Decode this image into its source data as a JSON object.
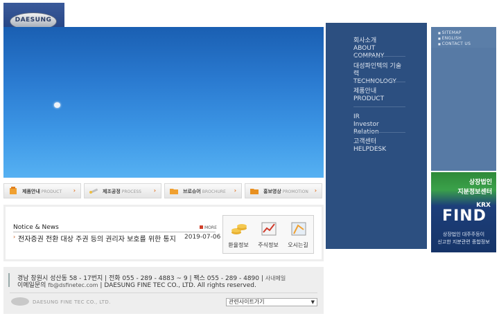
{
  "logo": {
    "text": "DAESUNG"
  },
  "quick_menu": [
    {
      "kr": "제품안내",
      "en": "PRODUCT"
    },
    {
      "kr": "제조공정",
      "en": "PROCESS"
    },
    {
      "kr": "브로슈어",
      "en": "BROCHURE"
    },
    {
      "kr": "홍보영상",
      "en": "PROMOTION"
    }
  ],
  "notice": {
    "title": "Notice & News",
    "more": "MORE",
    "items": [
      {
        "text": "전자증권 전환 대상 주권 등의 권리자 보호를 위한 통지",
        "date": "2019-07-06"
      }
    ]
  },
  "services": [
    {
      "label": "환율정보",
      "icon": "coins-icon"
    },
    {
      "label": "주식정보",
      "icon": "chart-icon"
    },
    {
      "label": "오시는길",
      "icon": "map-icon"
    }
  ],
  "footer": {
    "address": "경남 창원시 성산동 58 - 17번지 | 전화 055 - 289 - 4883 ~ 9 | 팩스 055 - 289 - 4890 |",
    "address_link": "사내메일",
    "copyright_prefix": "이메일문의",
    "copyright_email": "fb@dsfinetec.com",
    "copyright": "| DAESUNG FINE TEC CO., LTD. All rights reserved.",
    "company_name": "DAESUNG FINE TEC CO., LTD.",
    "related_sites": "관련사이트가기"
  },
  "nav": [
    {
      "kr": "회사소개",
      "en": "ABOUT COMPANY"
    },
    {
      "kr": "대성파인텍의 기술력",
      "en": "TECHNOLOGY"
    },
    {
      "kr": "제품안내",
      "en": "PRODUCT"
    },
    {
      "kr": "IR",
      "en": "Investor Relation"
    },
    {
      "kr": "고객센터",
      "en": "HELPDESK"
    }
  ],
  "util_links": [
    "SITEMAP",
    "ENGLISH",
    "CONTACT US"
  ],
  "banner": {
    "line1": "상장법인",
    "line2": "지분정보센터",
    "krx": "KRX",
    "find": "FIND",
    "sub1": "상장법인 대주주등이",
    "sub2": "신고한 지분관련 종합정보"
  },
  "colors": {
    "nav_bg": "#2c4f80",
    "accent_orange": "#e07020",
    "hero_top": "#1a5fb2"
  }
}
